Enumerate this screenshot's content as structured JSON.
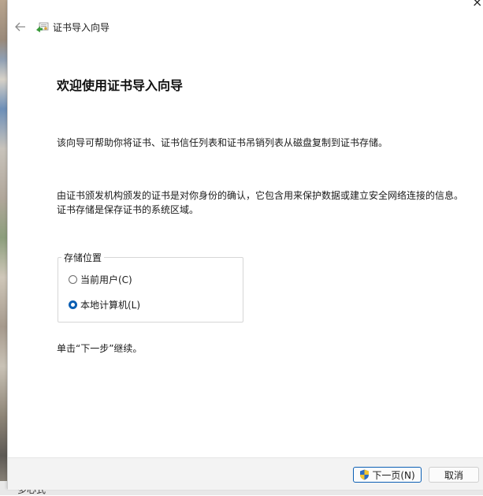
{
  "window": {
    "close_glyph": "×",
    "title": "证书导入向导"
  },
  "main": {
    "heading": "欢迎使用证书导入向导",
    "paragraph1": "该向导可帮助你将证书、证书信任列表和证书吊销列表从磁盘复制到证书存储。",
    "paragraph2": "由证书颁发机构颁发的证书是对你身份的确认，它包含用来保护数据或建立安全网络连接的信息。证书存储是保存证书的系统区域。",
    "store_location": {
      "legend": "存储位置",
      "options": [
        {
          "label": "当前用户(C)",
          "checked": false
        },
        {
          "label": "本地计算机(L)",
          "checked": true
        }
      ]
    },
    "hint": "单击“下一步”继续。"
  },
  "footer": {
    "next_label": "下一页(N)",
    "cancel_label": "取消"
  },
  "background": {
    "taskbar_text": "多心式"
  },
  "colors": {
    "accent": "#0a5eb3"
  },
  "icons": {
    "back": "arrow-left-icon",
    "wizard": "certificate-wizard-icon",
    "shield": "uac-shield-icon"
  }
}
